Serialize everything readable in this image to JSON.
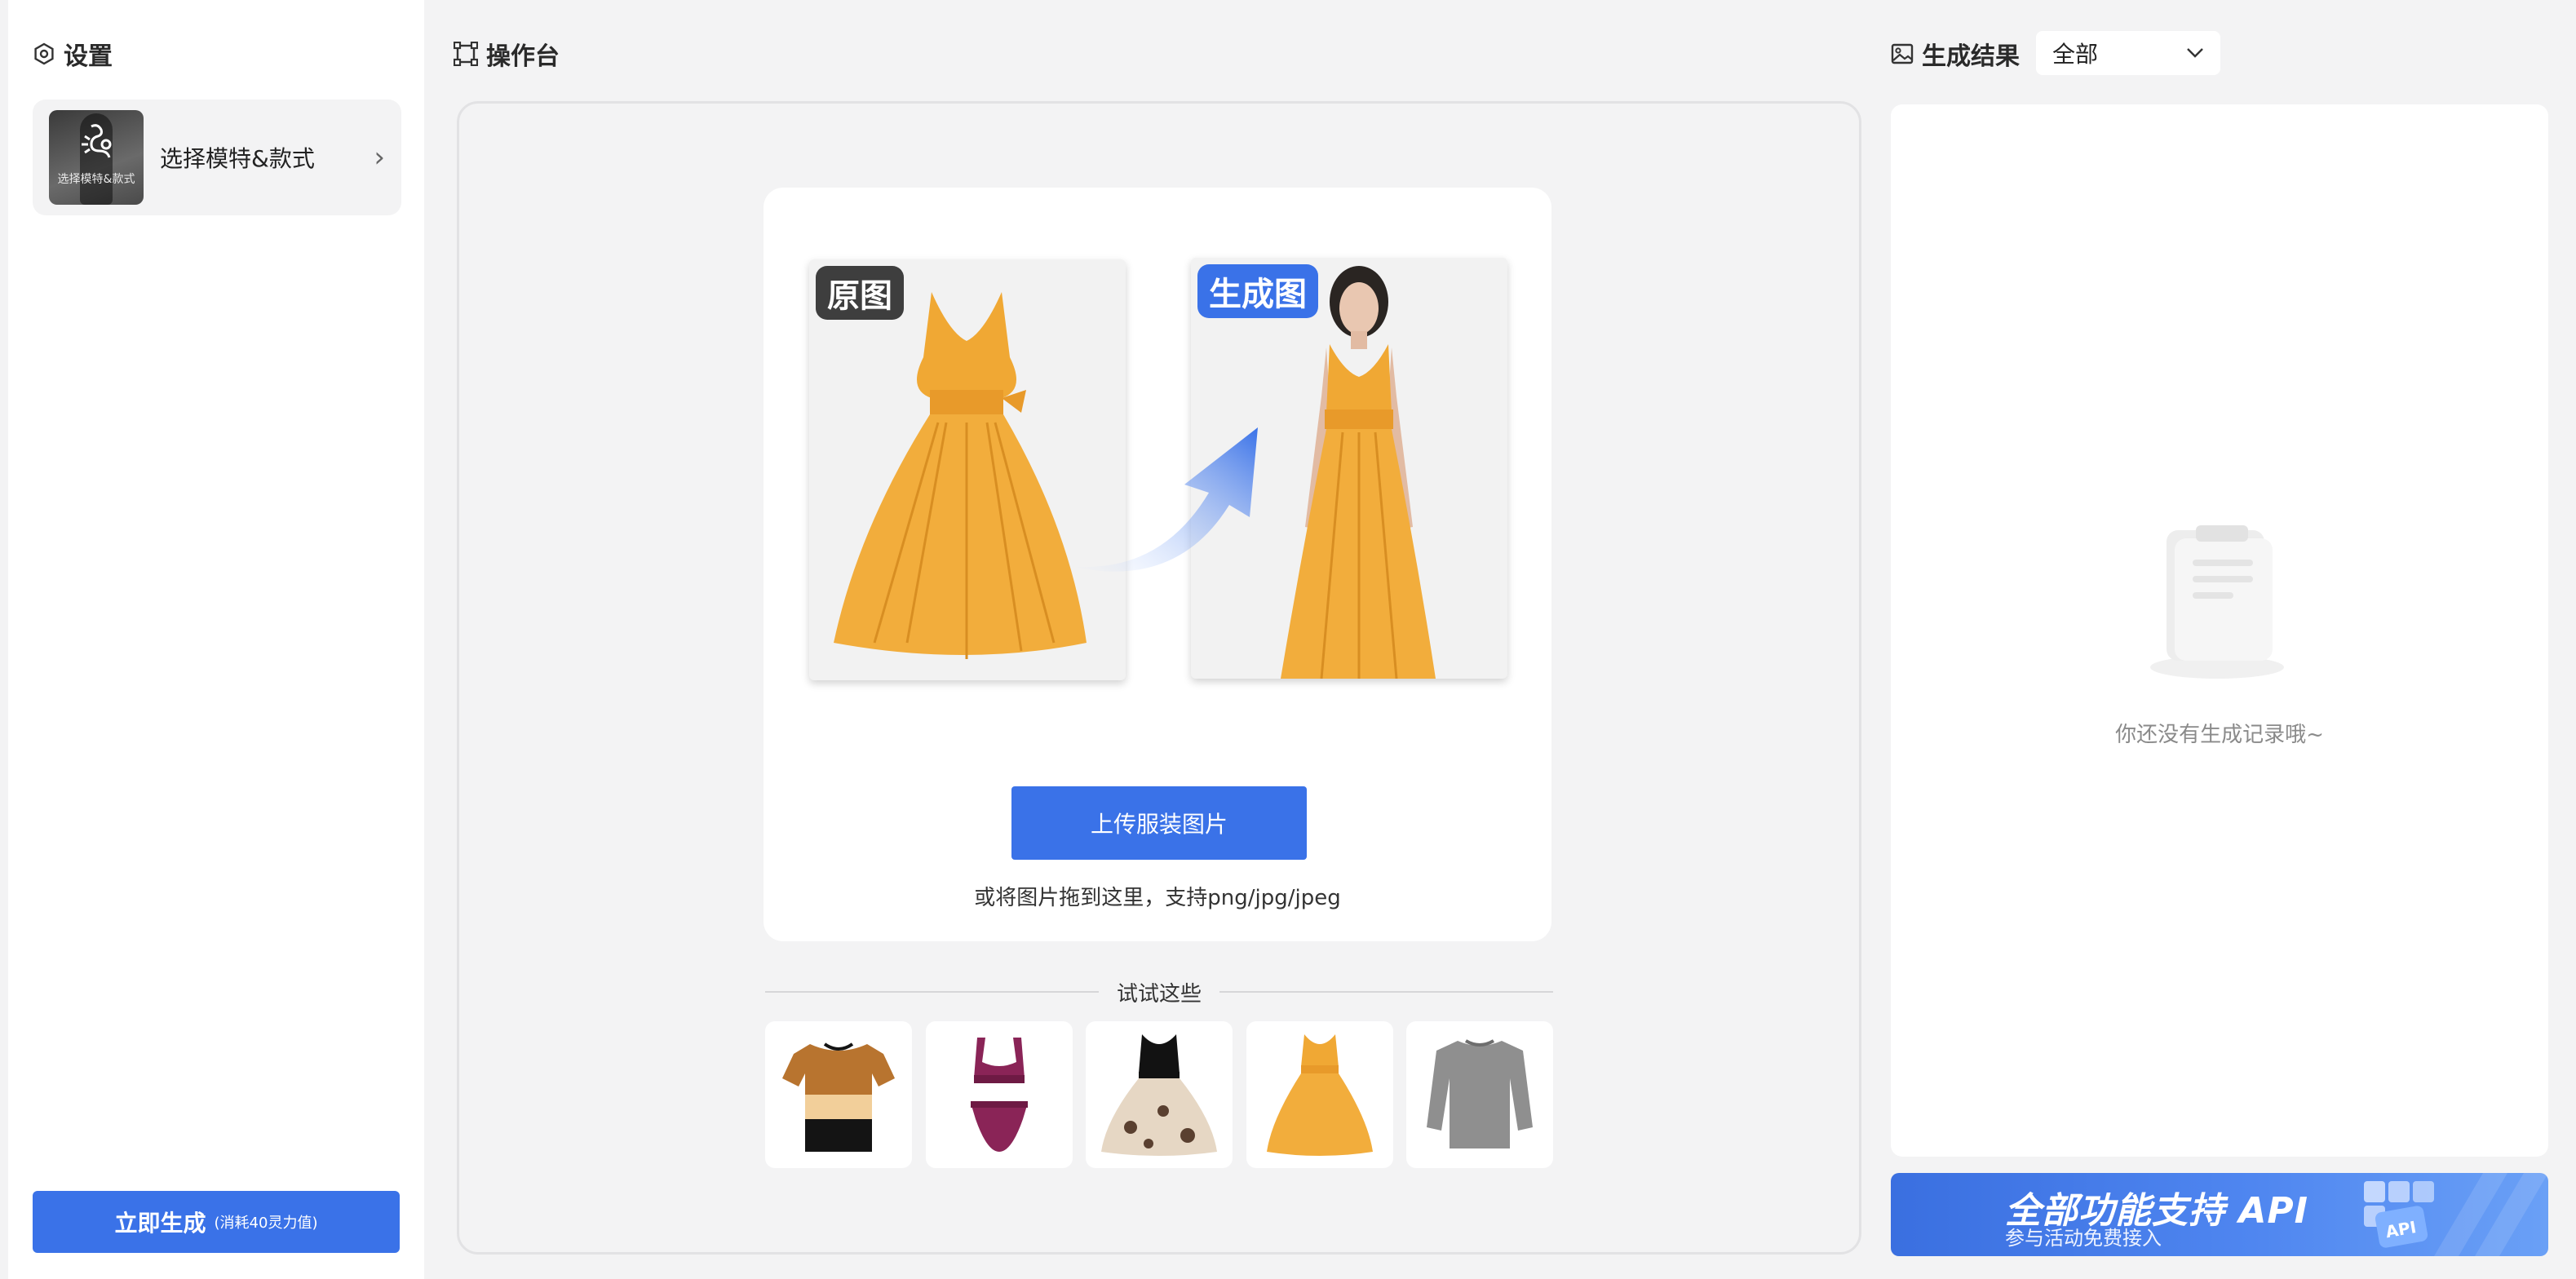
{
  "left": {
    "title": "设置",
    "model_card": {
      "thumb_text": "选择模特&款式",
      "label": "选择模特&款式"
    },
    "generate": {
      "label": "立即生成",
      "cost": "(消耗40灵力值)"
    }
  },
  "center": {
    "title": "操作台",
    "demo": {
      "original_tag": "原图",
      "generated_tag": "生成图"
    },
    "upload_button": "上传服装图片",
    "upload_hint": "或将图片拖到这里，支持png/jpg/jpeg",
    "try_label": "试试这些",
    "samples": [
      "tshirt",
      "bikini",
      "floral-dress",
      "yellow-dress",
      "sweater"
    ]
  },
  "right": {
    "title": "生成结果",
    "filter": {
      "selected": "全部"
    },
    "empty_text": "你还没有生成记录哦~",
    "banner": {
      "title": "全部功能支持 API",
      "subtitle": "参与活动免费接入",
      "cube_text": "API"
    }
  },
  "colors": {
    "accent": "#3a72e8",
    "panel": "#ffffff",
    "background": "#f3f3f4",
    "dress": "#f0a834"
  },
  "icons": [
    "settings-icon",
    "chevron-right-icon",
    "workbench-icon",
    "image-icon",
    "chevron-down-icon",
    "arrow-icon",
    "clipboard-icon"
  ]
}
